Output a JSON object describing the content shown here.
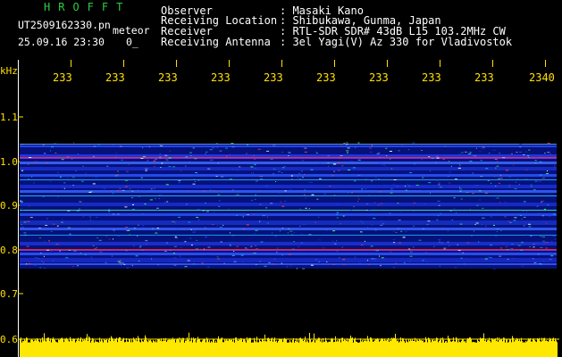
{
  "header": {
    "brand": "HROFFT",
    "filename": "UT2509162330.pn",
    "suffix": "meteor",
    "datetime": "25.09.16 23:30",
    "count": "0_",
    "fields": [
      {
        "key": "Observer",
        "value": ": Masaki Kano"
      },
      {
        "key": "Receiving Location",
        "value": ": Shibukawa, Gunma, Japan"
      },
      {
        "key": "Receiver",
        "value": ": RTL-SDR SDR# 43dB L15 103.2MHz CW"
      },
      {
        "key": "Receiving Antenna",
        "value": ": 3el Yagi(V) Az 330 for Vladivostok"
      }
    ]
  },
  "axes": {
    "y_unit": "kHz",
    "y_ticks": [
      "1.1",
      "1.0",
      "0.9",
      "0.8",
      "0.7",
      "0.6"
    ],
    "x_ticks": [
      "233",
      "233",
      "233",
      "233",
      "233",
      "233",
      "233",
      "233",
      "233",
      "2340"
    ]
  },
  "colors": {
    "axis_text": "#ffe000",
    "brand": "#2ecc40",
    "noise_floor": "#ffe800",
    "background": "#000000"
  }
}
